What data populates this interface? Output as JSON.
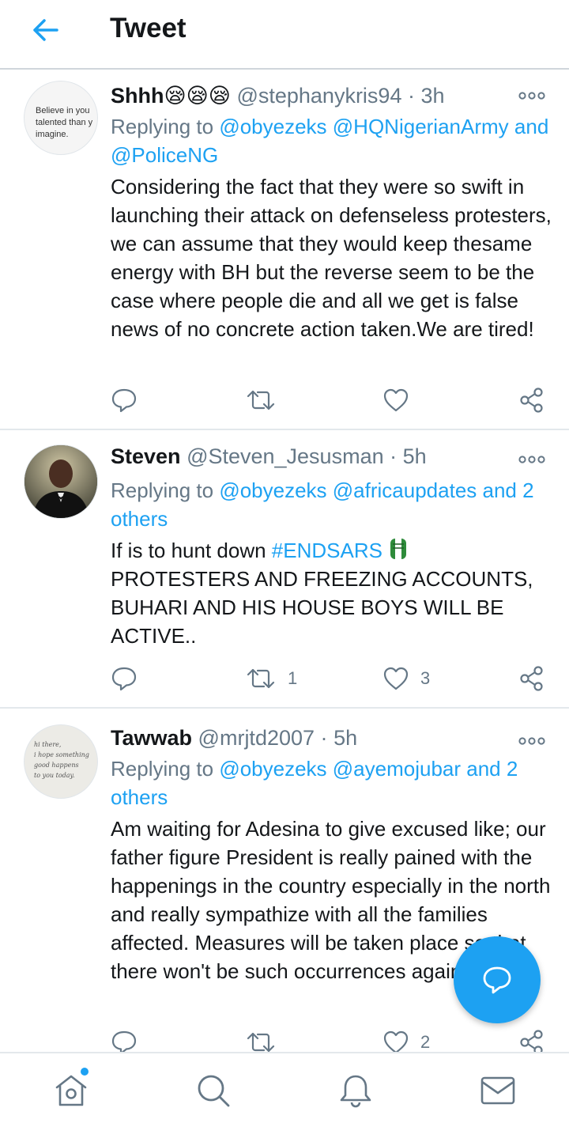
{
  "header": {
    "title": "Tweet"
  },
  "colors": {
    "accent": "#1da1f2",
    "text": "#14171a",
    "muted": "#657786"
  },
  "tweets": [
    {
      "name": "Shhh😪😪😪",
      "handle": "@stephanykris94",
      "separator": "·",
      "time": "3h",
      "replying_prefix": "Replying to",
      "replying_links": [
        "@obyezeks",
        "@HQNigerianArmy"
      ],
      "replying_and": "and",
      "replying_last": "@PoliceNG",
      "avatar_text": [
        "Believe in you",
        "talented than y",
        "imagine."
      ],
      "text": "Considering the fact that they were so swift in launching their attack on  defenseless protesters, we can assume that they would keep thesame energy with BH but the reverse seem to be the case where people die and all we get is false news of no concrete action taken.We are tired!",
      "reply_count": "",
      "retweet_count": "",
      "like_count": ""
    },
    {
      "name": "Steven",
      "handle": "@Steven_Jesusman",
      "separator": "·",
      "time": "5h",
      "replying_prefix": "Replying to",
      "replying_links": [
        "@obyezeks",
        "@africaupdates"
      ],
      "replying_and": "and",
      "replying_last": "2 others",
      "text_before": "If is to hunt down ",
      "hashtag": "#ENDSARS",
      "text_after": "PROTESTERS AND FREEZING ACCOUNTS, BUHARI AND HIS HOUSE BOYS WILL BE ACTIVE..",
      "reply_count": "",
      "retweet_count": "1",
      "like_count": "3"
    },
    {
      "name": "Tawwab",
      "handle": "@mrjtd2007",
      "separator": "·",
      "time": "5h",
      "replying_prefix": "Replying to",
      "replying_links": [
        "@obyezeks",
        "@ayemojubar"
      ],
      "replying_and": "and 2",
      "replying_last": "others",
      "avatar_text": [
        "hi there,",
        "i hope something",
        "good happens",
        "to you today."
      ],
      "text": "Am waiting for Adesina to give excused like; our father figure President is really pained with the happenings in the country especially in the north and really sympathize with all the families affected. Measures will be taken place so that there won't be such occurrences again.",
      "reply_count": "",
      "retweet_count": "",
      "like_count": "2"
    }
  ]
}
